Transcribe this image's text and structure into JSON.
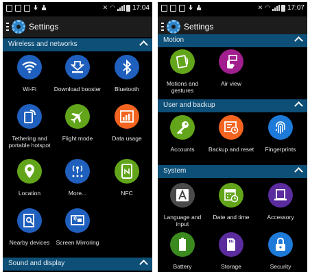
{
  "colors": {
    "section_bar": "#0d4f77",
    "title_bar": "#1c1c1c",
    "blue": "#1f5fbd",
    "green": "#62a51b",
    "orange": "#f2641f",
    "purple": "#5a2c9e",
    "magenta": "#a11e8f",
    "light_blue": "#1e7ad8",
    "dark_gray": "#4a4a4a"
  },
  "left_screen": {
    "status": {
      "time": "17:04"
    },
    "title": "Settings",
    "sections": [
      {
        "label": "Wireless and networks",
        "items": [
          {
            "label": "Wi-Fi",
            "icon": "wifi-icon"
          },
          {
            "label": "Download booster",
            "icon": "download-booster-icon"
          },
          {
            "label": "Bluetooth",
            "icon": "bluetooth-icon"
          },
          {
            "label": "Tethering and portable hotspot",
            "icon": "tethering-icon"
          },
          {
            "label": "Flight mode",
            "icon": "airplane-icon"
          },
          {
            "label": "Data usage",
            "icon": "data-usage-icon"
          },
          {
            "label": "Location",
            "icon": "location-pin-icon"
          },
          {
            "label": "More...",
            "icon": "more-networks-icon"
          },
          {
            "label": "NFC",
            "icon": "nfc-icon"
          },
          {
            "label": "Nearby devices",
            "icon": "nearby-devices-icon"
          },
          {
            "label": "Screen Mirroring",
            "icon": "screen-mirroring-icon"
          }
        ]
      },
      {
        "label": "Sound and display",
        "items": []
      }
    ]
  },
  "right_screen": {
    "status": {
      "time": "17:07"
    },
    "title": "Settings",
    "sections": [
      {
        "label": "Motion",
        "items": [
          {
            "label": "Motions and gestures",
            "icon": "motions-gestures-icon"
          },
          {
            "label": "Air view",
            "icon": "air-view-icon"
          }
        ]
      },
      {
        "label": "User and backup",
        "items": [
          {
            "label": "Accounts",
            "icon": "key-icon"
          },
          {
            "label": "Backup and reset",
            "icon": "backup-reset-icon"
          },
          {
            "label": "Fingerprints",
            "icon": "fingerprint-icon"
          }
        ]
      },
      {
        "label": "System",
        "items": [
          {
            "label": "Language and input",
            "icon": "language-input-icon"
          },
          {
            "label": "Date and time",
            "icon": "calendar-clock-icon"
          },
          {
            "label": "Accessory",
            "icon": "accessory-icon"
          },
          {
            "label": "Battery",
            "icon": "battery-icon"
          },
          {
            "label": "Storage",
            "icon": "storage-card-icon"
          },
          {
            "label": "Security",
            "icon": "lock-icon"
          }
        ]
      }
    ]
  }
}
